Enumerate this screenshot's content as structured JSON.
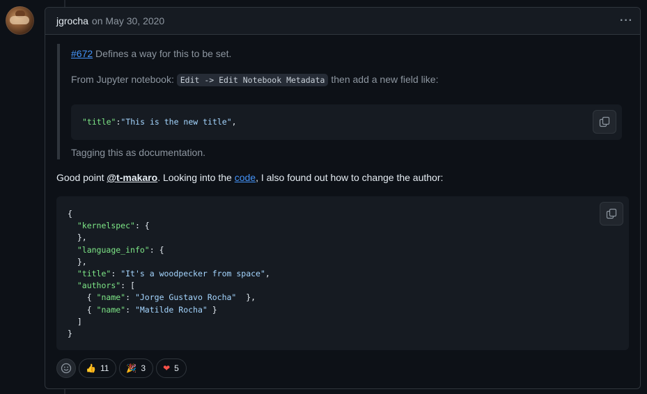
{
  "comment": {
    "author": "jgrocha",
    "date_text": "on May 30, 2020",
    "menu_icon": "kebab-horizontal-icon"
  },
  "quote": {
    "issue_ref": "#672",
    "line1_rest": " Defines a way for this to be set.",
    "line2_prefix": "From Jupyter notebook: ",
    "line2_code": "Edit -> Edit Notebook Metadata",
    "line2_suffix": " then add a new field like:",
    "code_key": "\"title\"",
    "code_colon": ":",
    "code_value": "\"This is the new title\"",
    "code_comma": ",",
    "line3": "Tagging this as documentation."
  },
  "body": {
    "prefix": "Good point ",
    "mention": "@t-makaro",
    "middle": ". Looking into the ",
    "link": "code",
    "suffix": ", I also found out how to change the author:"
  },
  "code_block": {
    "lines": [
      "{",
      "  \"kernelspec\": {",
      "  },",
      "  \"language_info\": {",
      "  },",
      "  \"title\": \"It's a woodpecker from space\",",
      "  \"authors\": [",
      "    { \"name\": \"Jorge Gustavo Rocha\"  },",
      "    { \"name\": \"Matilde Rocha\" }",
      "  ]",
      "}"
    ]
  },
  "reactions": [
    {
      "emoji": "👍",
      "icon": "thumbs-up-icon",
      "count": "11"
    },
    {
      "emoji": "🎉",
      "icon": "party-popper-icon",
      "count": "3"
    },
    {
      "emoji": "❤",
      "icon": "heart-icon",
      "count": "5"
    }
  ],
  "colors": {
    "background": "#0d1117",
    "link": "#4493f8",
    "json_key": "#7ee787",
    "json_string": "#a5d6ff",
    "heart": "#f85149"
  }
}
